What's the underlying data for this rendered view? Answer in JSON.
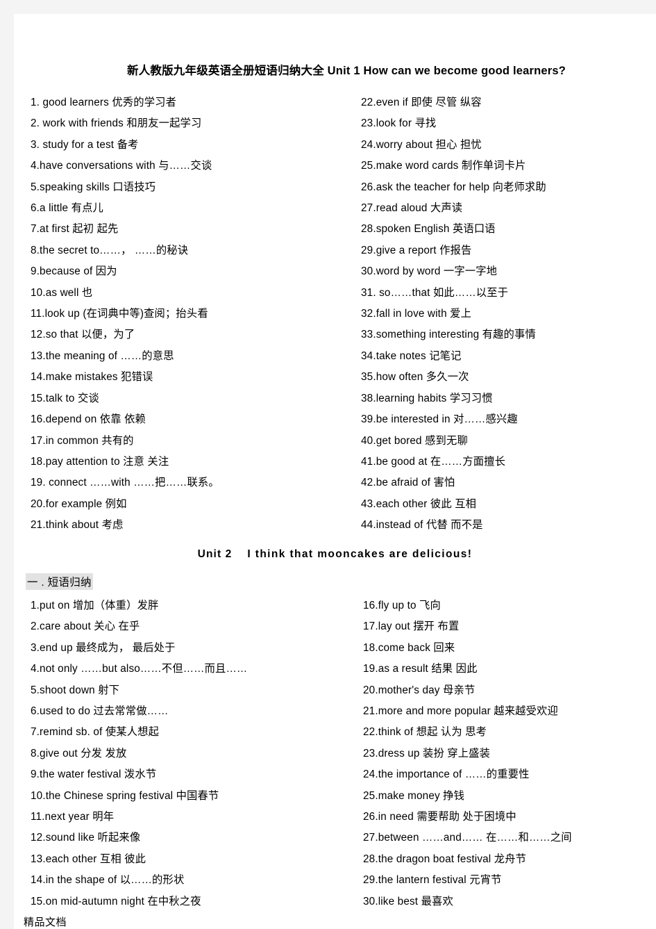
{
  "document": {
    "title": "新人教版九年级英语全册短语归纳大全 Unit 1    How can we become good learners?",
    "footer_note": "精品文档"
  },
  "unit1": {
    "heading": "新人教版九年级英语全册短语归纳大全 Unit 1    How can we become good learners?",
    "left_column": [
      "1. good learners  优秀的学习者",
      "2. work with friends    和朋友一起学习",
      "3. study for a test  备考",
      "4.have conversations with    与……交谈",
      "5.speaking skills  口语技巧",
      "6.a little    有点儿",
      "7.at first  起初    起先",
      "8.the    secret    to……，  ……的秘诀",
      "9.because of    因为",
      "10.as well    也",
      "11.look up    (在词典中等)查阅；抬头看",
      "12.so that    以便，为了",
      "13.the meaning    of    ……的意思",
      "14.make mistakes    犯错误",
      "15.talk to  交谈",
      "16.depend on    依靠  依赖",
      "17.in common  共有的",
      "18.pay attention    to   注意 关注",
      "19. connect ……with ……把……联系。",
      "20.for    example    例如",
      "21.think about  考虑"
    ],
    "right_column": [
      "22.even if    即使   尽管   纵容",
      "23.look for  寻找",
      "24.worry about  担心 担忧",
      "25.make word cards    制作单词卡片",
      "26.ask the teacher for help  向老师求助",
      "27.read aloud  大声读",
      "28.spoken English    英语口语",
      "29.give a report    作报告",
      "30.word by word  一字一字地",
      "31. so……that    如此……以至于",
      "32.fall in love with    爱上",
      "33.something    interesting  有趣的事情",
      "34.take notes    记笔记",
      "35.how often  多久一次",
      "38.learning    habits  学习习惯",
      "39.be    interested    in   对……感兴趣",
      "40.get bored  感到无聊",
      "41.be good at  在……方面擅长",
      "42.be afraid of  害怕",
      "43.each other  彼此 互相",
      "44.instead of    代替 而不是"
    ]
  },
  "unit2": {
    "heading_lead": "Unit 2",
    "heading_main": "I think that mooncakes are delicious!",
    "section_label": "一 . 短语归纳",
    "left_column": [
      "1.put on  增加（体重）发胖",
      "2.care about  关心 在乎",
      "3.end up  最终成为，  最后处于",
      "4.not only ……but also……不但……而且……",
      "5.shoot down  射下",
      "6.used to do  过去常常做……",
      "7.remind sb. of  使某人想起",
      "8.give out  分发   发放",
      "9.the water festival  泼水节",
      "10.the Chinese spring festival  中国春节",
      "11.next year  明年",
      "12.sound like  听起来像",
      "13.each other  互相 彼此",
      "14.in the shape of    以……的形状",
      "15.on mid-autumn    night  在中秋之夜"
    ],
    "right_column": [
      "16.fly up to  飞向",
      "17.lay out  摆开 布置",
      "18.come back  回来",
      "19.as a result    结果 因此",
      "20.mother's day    母亲节",
      "21.more and more popular  越来越受欢迎",
      "22.think of  想起 认为 思考",
      "23.dress up    装扮 穿上盛装",
      "24.the    importance of ……的重要性",
      "25.make    money   挣钱",
      "26.in need  需要帮助   处于困境中",
      "27.between ……and……   在……和……之间",
      "28.the dragon boat festival    龙舟节",
      "29.the lantern    festival    元宵节",
      "30.like best  最喜欢"
    ]
  }
}
